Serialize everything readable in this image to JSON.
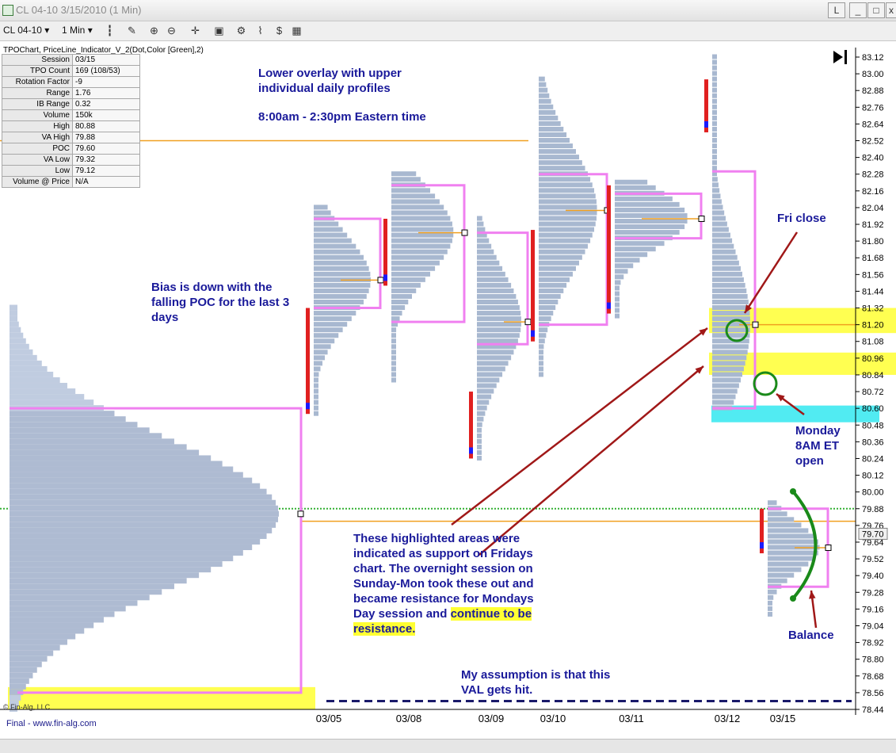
{
  "window": {
    "title": "CL 04-10  3/15/2010 (1 Min)",
    "buttons": [
      "L",
      "_",
      "□",
      "x"
    ]
  },
  "toolbar": {
    "symbol": "CL 04-10",
    "interval": "1 Min",
    "dropdown_glyph": "▾",
    "icons": [
      "bar-chart-icon",
      "pen-icon",
      "zoom-in-icon",
      "zoom-out-icon",
      "crosshair-icon",
      "layout-icon",
      "properties-icon",
      "money-icon",
      "grid-icon"
    ]
  },
  "indicator_label": "TPOChart, PriceLine_Indicator_V_2(Dot,Color [Green],2)",
  "stats": [
    {
      "label": "Session",
      "value": "03/15"
    },
    {
      "label": "TPO Count",
      "value": "169 (108/53)"
    },
    {
      "label": "Rotation Factor",
      "value": "-9"
    },
    {
      "label": "Range",
      "value": "1.76"
    },
    {
      "label": "IB Range",
      "value": "0.32"
    },
    {
      "label": "Volume",
      "value": "150k"
    },
    {
      "label": "High",
      "value": "80.88"
    },
    {
      "label": "VA High",
      "value": "79.88"
    },
    {
      "label": "POC",
      "value": "79.60"
    },
    {
      "label": "VA Low",
      "value": "79.32"
    },
    {
      "label": "Low",
      "value": "79.12"
    },
    {
      "label": "Volume @ Price",
      "value": "N/A"
    }
  ],
  "annotations": {
    "overlay": "Lower overlay with upper individual daily profiles",
    "hours": "8:00am - 2:30pm Eastern time",
    "bias": "Bias is down with the falling POC for the last 3 days",
    "fri_close": "Fri close",
    "monday_open": "Monday 8AM ET open",
    "highlighted_main": "These highlighted areas were indicated as support on Fridays chart.  The overnight session on Sunday-Mon took these out and became resistance for Mondays Day session and",
    "highlighted_emph": "continue to be resistance.",
    "assumption": "My assumption is that this VAL gets hit.",
    "balance": "Balance"
  },
  "footer": {
    "copyright": "© Fin-Alg, LLC",
    "brand": "Final - www.fin-alg.com"
  },
  "chart_data": {
    "type": "market-profile (TPO)",
    "symbol": "CL 04-10",
    "interval": "1 Min",
    "y_axis": {
      "min": 78.44,
      "max": 83.12,
      "ticks": [
        83.12,
        83.0,
        82.88,
        82.76,
        82.64,
        82.52,
        82.4,
        82.28,
        82.16,
        82.04,
        81.92,
        81.8,
        81.68,
        81.56,
        81.44,
        81.32,
        81.2,
        81.08,
        80.96,
        80.84,
        80.72,
        80.6,
        80.48,
        80.36,
        80.24,
        80.12,
        80.0,
        79.88,
        79.76,
        79.64,
        79.52,
        79.4,
        79.28,
        79.16,
        79.04,
        78.92,
        78.8,
        78.68,
        78.56,
        78.44
      ]
    },
    "x_axis": {
      "ticks": [
        "03/05",
        "03/08",
        "03/09",
        "03/10",
        "03/11",
        "03/12",
        "03/15"
      ]
    },
    "current_price": 79.7,
    "composite_profile": {
      "val": 78.56,
      "poc": 79.84,
      "vah": 80.6,
      "high": 81.32,
      "low": 78.44
    },
    "daily_profiles": [
      {
        "date": "03/05",
        "high": 82.04,
        "low": 80.56,
        "vah": 81.96,
        "poc": 81.52,
        "val": 81.32,
        "ib_high": 81.32,
        "ib_low": 80.56
      },
      {
        "date": "03/08",
        "high": 82.28,
        "low": 80.8,
        "vah": 82.2,
        "poc": 81.86,
        "val": 81.22,
        "ib_high": 81.96,
        "ib_low": 81.48
      },
      {
        "date": "03/09",
        "high": 81.96,
        "low": 80.24,
        "vah": 81.86,
        "poc": 81.22,
        "val": 81.06,
        "ib_high": 80.72,
        "ib_low": 80.24
      },
      {
        "date": "03/10",
        "high": 82.96,
        "low": 80.84,
        "vah": 82.28,
        "poc": 82.02,
        "val": 81.2,
        "ib_high": 81.88,
        "ib_low": 81.08
      },
      {
        "date": "03/11",
        "high": 82.24,
        "low": 81.26,
        "vah": 82.14,
        "poc": 81.96,
        "val": 81.82,
        "ib_high": 82.2,
        "ib_low": 81.28
      },
      {
        "date": "03/12",
        "high": 83.12,
        "low": 80.6,
        "vah": 82.3,
        "poc": 81.2,
        "val": 80.6,
        "ib_high": 82.96,
        "ib_low": 82.58
      },
      {
        "date": "03/15",
        "high": 79.94,
        "low": 79.12,
        "vah": 79.88,
        "poc": 79.6,
        "val": 79.32,
        "ib_high": 79.88,
        "ib_low": 79.56
      }
    ],
    "horizontal_lines": [
      {
        "price": 82.52,
        "color": "#f0a020"
      },
      {
        "price": 81.2,
        "color": "#f0a020"
      },
      {
        "price": 79.88,
        "color": "#33b033",
        "style": "dotted"
      },
      {
        "price": 79.79,
        "color": "#f0a020"
      },
      {
        "price": 78.5,
        "color": "#1a1a6a",
        "style": "dashed"
      }
    ],
    "highlight_zones": [
      {
        "from": 81.14,
        "to": 81.32,
        "color": "#ffff33"
      },
      {
        "from": 80.84,
        "to": 81.0,
        "color": "#ffff33"
      },
      {
        "from": 80.5,
        "to": 80.62,
        "color": "#33e8f0"
      },
      {
        "from": 78.44,
        "to": 78.6,
        "color": "#ffff33"
      }
    ],
    "colors": {
      "profile_fill": "#a8b8d0",
      "value_area": "#f080f0",
      "ib_bar": "#e02020",
      "open_marker": "#1a1aff",
      "poc_line": "#f0a020"
    }
  }
}
